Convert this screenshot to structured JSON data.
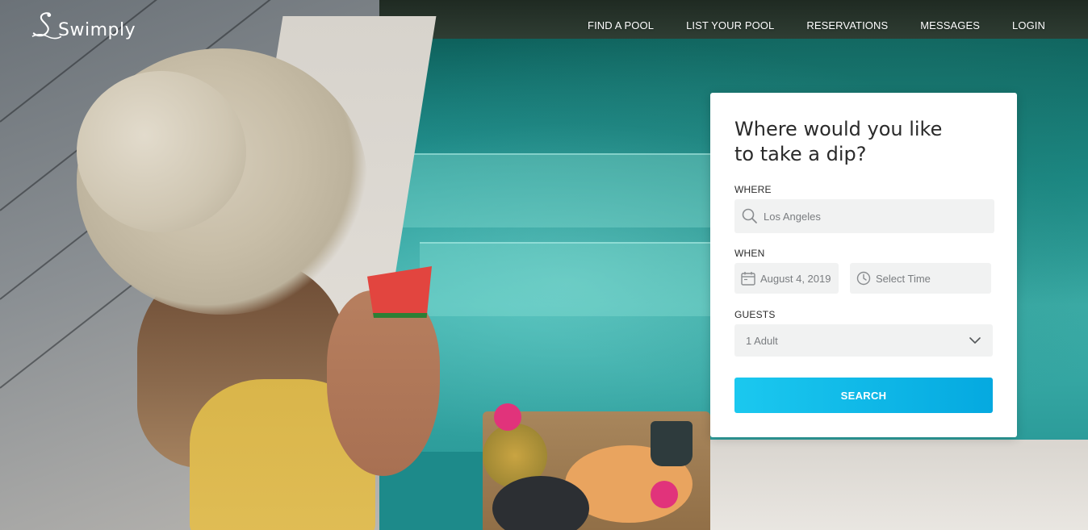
{
  "brand": {
    "name": "Swimply"
  },
  "nav": {
    "items": [
      {
        "label": "FIND A POOL"
      },
      {
        "label": "LIST YOUR POOL"
      },
      {
        "label": "RESERVATIONS"
      },
      {
        "label": "MESSAGES"
      },
      {
        "label": "LOGIN"
      }
    ]
  },
  "search_card": {
    "title": "Where would you like to take a dip?",
    "where": {
      "label": "WHERE",
      "value": "Los Angeles",
      "icon": "search-icon"
    },
    "when": {
      "label": "WHEN",
      "date_value": "August 4, 2019",
      "date_icon": "calendar-icon",
      "time_placeholder": "Select Time",
      "time_icon": "clock-icon"
    },
    "guests": {
      "label": "GUESTS",
      "value": "1 Adult",
      "icon": "chevron-down-icon"
    },
    "search_button": "SEARCH"
  },
  "colors": {
    "accent_start": "#1bc8ef",
    "accent_end": "#05a9e0",
    "card_bg": "#ffffff",
    "field_bg": "#f1f2f2"
  }
}
